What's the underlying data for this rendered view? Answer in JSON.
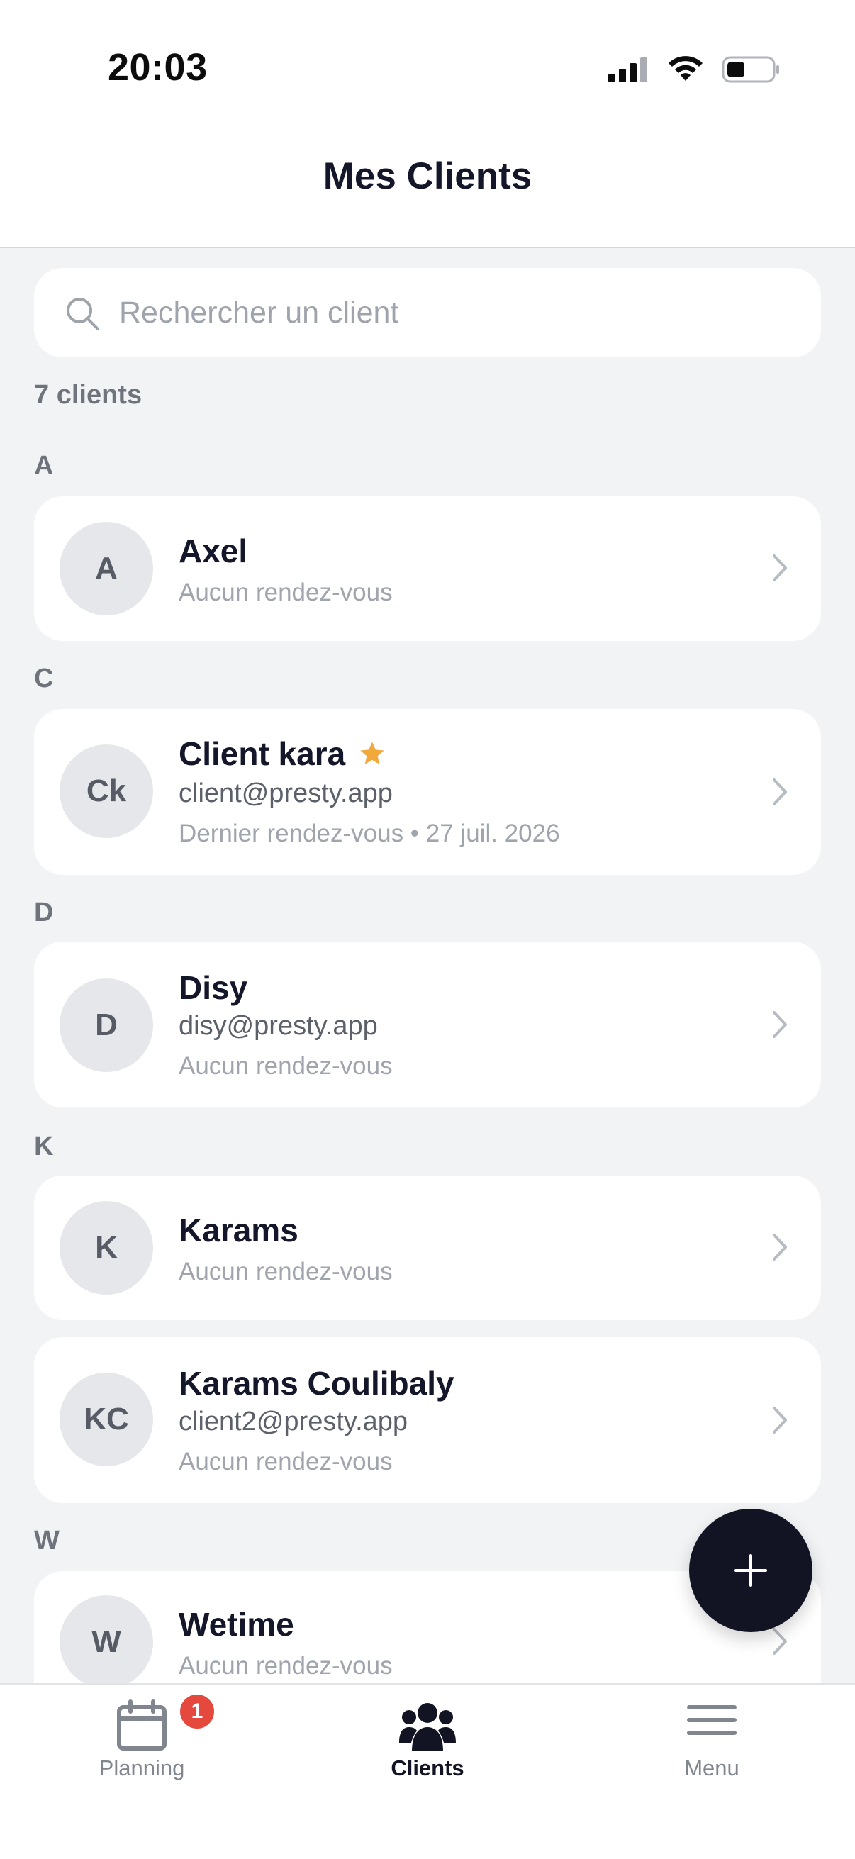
{
  "status_bar": {
    "time": "20:03"
  },
  "header": {
    "title": "Mes Clients"
  },
  "search": {
    "placeholder": "Rechercher un client"
  },
  "summary": {
    "count_label": "7 clients"
  },
  "sections": [
    {
      "letter": "A"
    },
    {
      "letter": "C"
    },
    {
      "letter": "D"
    },
    {
      "letter": "K"
    },
    {
      "letter": "W"
    }
  ],
  "clients": [
    {
      "initials": "A",
      "name": "Axel",
      "email": "",
      "status": "Aucun rendez-vous",
      "favorite": false
    },
    {
      "initials": "Ck",
      "name": "Client kara",
      "email": "client@presty.app",
      "status": "Dernier rendez-vous • 27 juil. 2026",
      "favorite": true
    },
    {
      "initials": "D",
      "name": "Disy",
      "email": "disy@presty.app",
      "status": "Aucun rendez-vous",
      "favorite": false
    },
    {
      "initials": "K",
      "name": "Karams",
      "email": "",
      "status": "Aucun rendez-vous",
      "favorite": false
    },
    {
      "initials": "KC",
      "name": "Karams Coulibaly",
      "email": "client2@presty.app",
      "status": "Aucun rendez-vous",
      "favorite": false
    },
    {
      "initials": "W",
      "name": "Wetime",
      "email": "",
      "status": "Aucun rendez-vous",
      "favorite": false
    }
  ],
  "tabbar": {
    "items": [
      {
        "label": "Planning",
        "icon": "calendar-icon",
        "badge": "1"
      },
      {
        "label": "Clients",
        "icon": "users-icon",
        "active": true
      },
      {
        "label": "Menu",
        "icon": "hamburger-menu-icon"
      }
    ]
  },
  "colors": {
    "accent": "#121424",
    "star": "#f0a93a",
    "badge": "#e5483d"
  }
}
